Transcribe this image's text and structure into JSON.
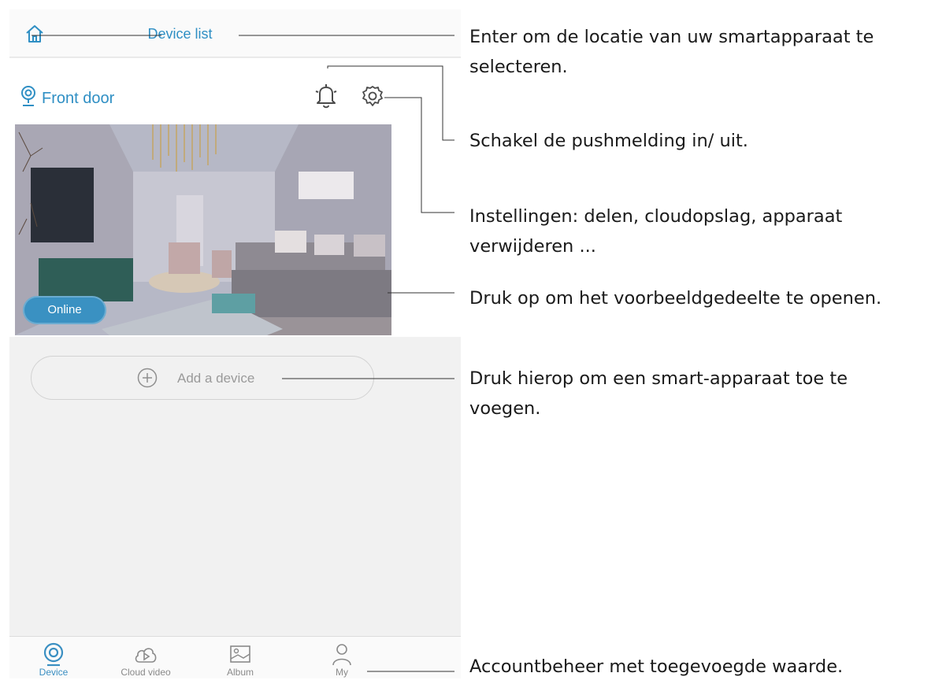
{
  "header": {
    "title": "Device list"
  },
  "device": {
    "name": "Front door",
    "status": "Online"
  },
  "add_device": {
    "label": "Add a device"
  },
  "tabs": [
    {
      "label": "Device"
    },
    {
      "label": "Cloud video"
    },
    {
      "label": "Album"
    },
    {
      "label": "My"
    }
  ],
  "callouts": {
    "location": [
      "Enter om de locatie van uw smartapparaat te",
      "selecteren."
    ],
    "push": "Schakel de pushmelding in/ uit.",
    "settings": [
      "Instellingen: delen, cloudopslag, apparaat",
      "verwijderen ..."
    ],
    "preview": "Druk op om het voorbeeldgedeelte te openen.",
    "add": [
      "Druk hierop om een smart-apparaat toe te",
      "voegen."
    ],
    "account": "Accountbeheer met toegevoegde waarde."
  },
  "colors": {
    "accent": "#2f8fc4",
    "background": "#f1f1f1",
    "badge": "#3a91c2"
  }
}
